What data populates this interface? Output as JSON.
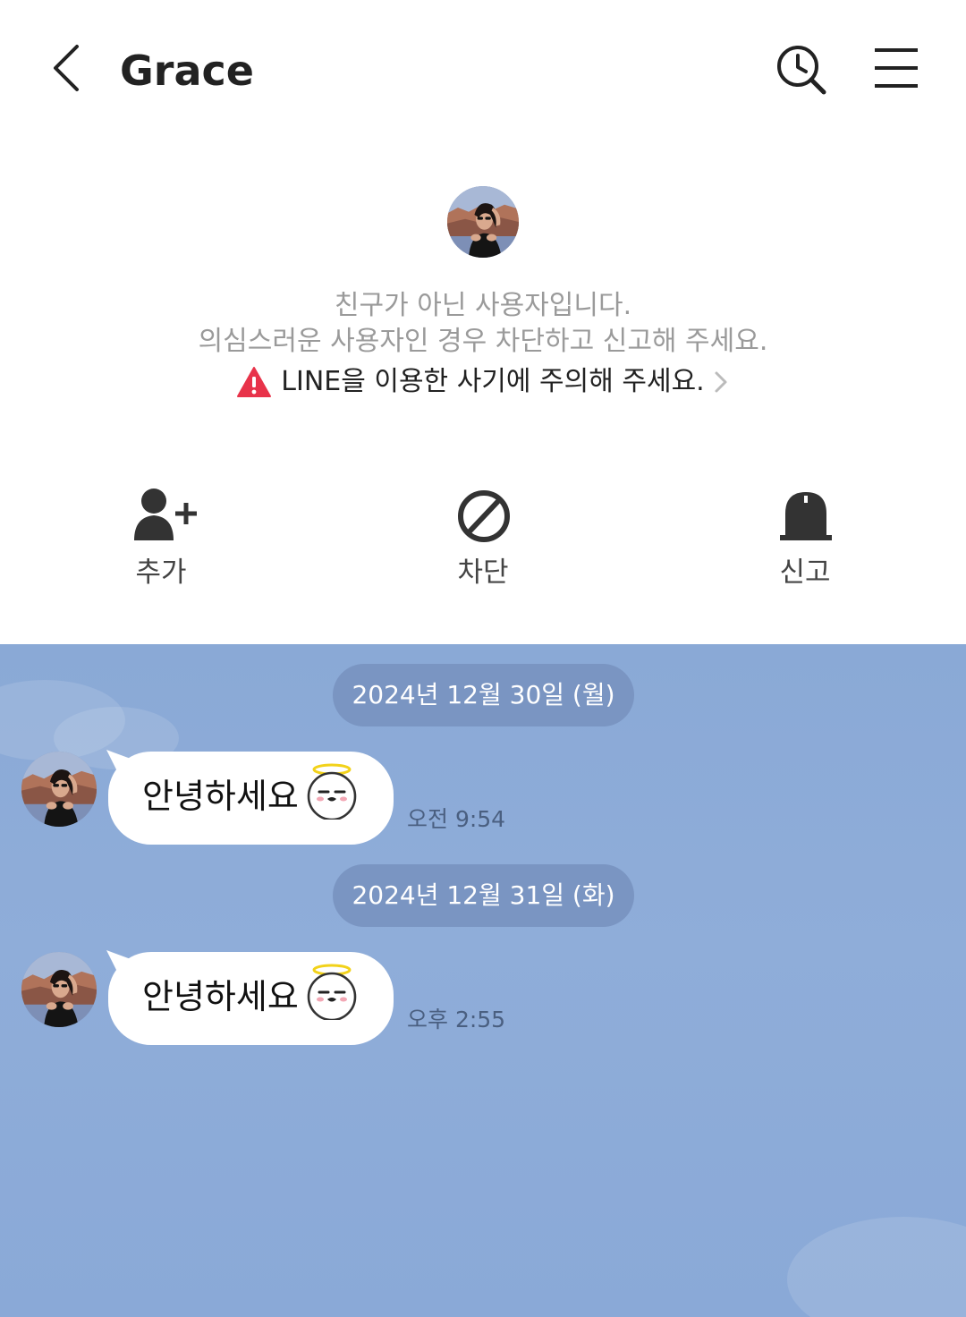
{
  "header": {
    "title": "Grace",
    "back_icon": "chevron-left-icon",
    "search_icon": "history-search-icon",
    "menu_icon": "menu-icon"
  },
  "profile": {
    "notice_line1": "친구가 아닌 사용자입니다.",
    "notice_line2": "의심스러운 사용자인 경우 차단하고 신고해 주세요.",
    "warning_text": "LINE을 이용한 사기에 주의해 주세요.",
    "warning_color": "#e8334a"
  },
  "actions": [
    {
      "label": "추가",
      "icon": "add-friend-icon"
    },
    {
      "label": "차단",
      "icon": "block-icon"
    },
    {
      "label": "신고",
      "icon": "report-icon"
    }
  ],
  "chat": {
    "background": "#8aa9d6",
    "pill_color": "#7a95c2",
    "messages": [
      {
        "date": "2024년 12월 30일 (월)",
        "text": "안녕하세요",
        "time": "오전 9:54"
      },
      {
        "date": "2024년 12월 31일 (화)",
        "text": "안녕하세요",
        "time": "오후 2:55"
      }
    ]
  }
}
